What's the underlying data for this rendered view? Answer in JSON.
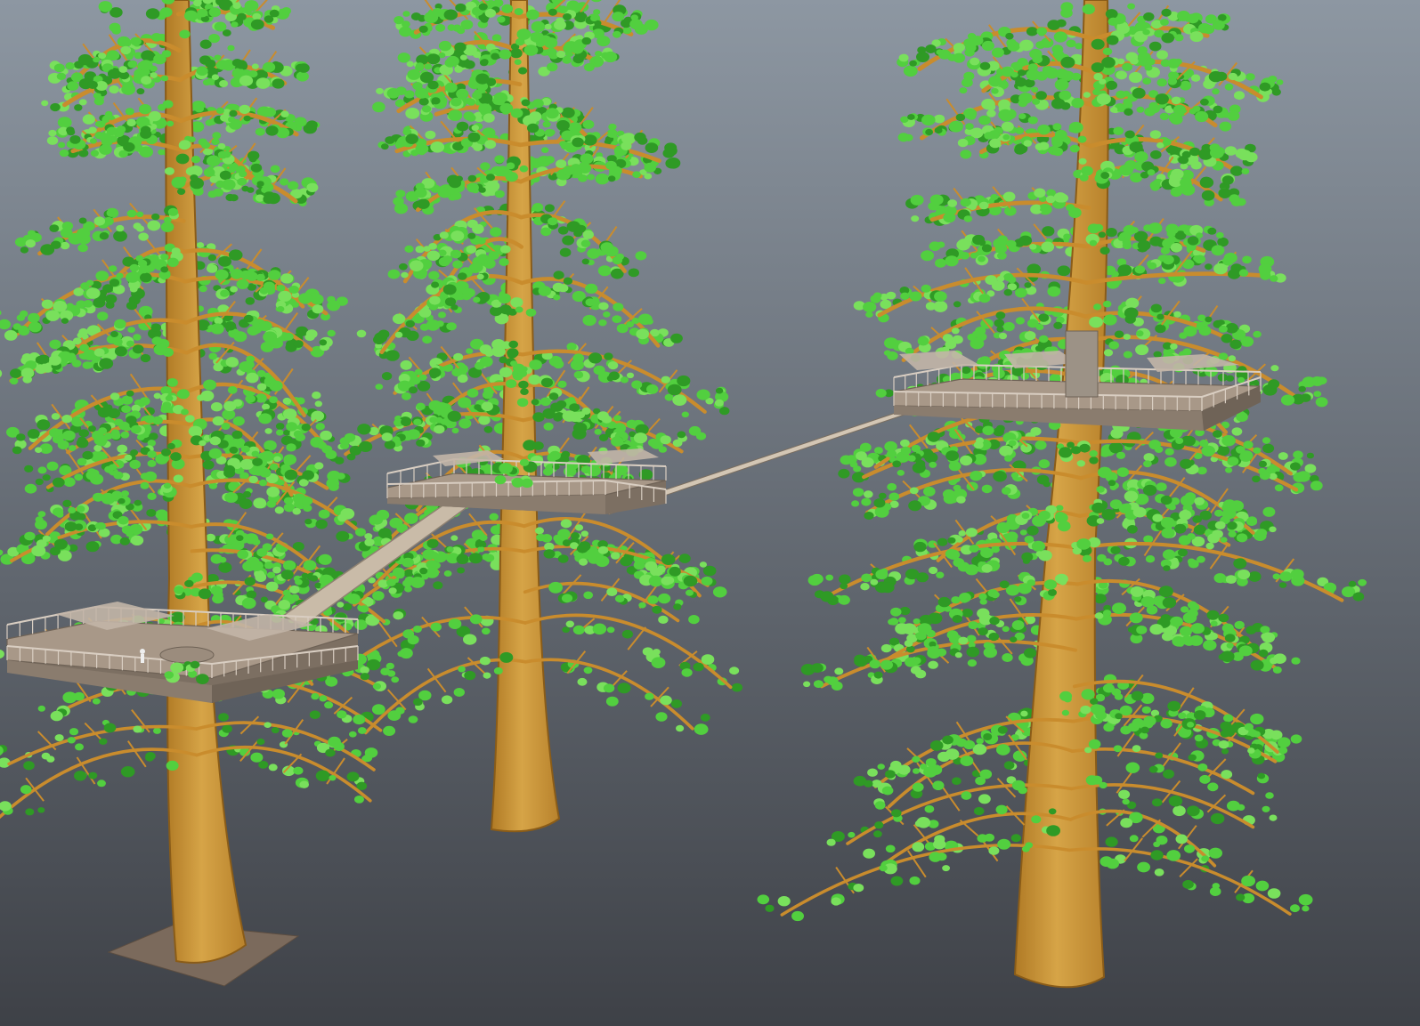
{
  "viewport": {
    "background_top": "#8d97a2",
    "background_bottom": "#3e4147",
    "label": ""
  },
  "colors": {
    "trunk": "#c8963a",
    "trunk_shade": "#9c6c1f",
    "branch": "#c98c2d",
    "leaf": "#52cf3f",
    "leaf_dark": "#2f9a25",
    "leaf_light": "#79e05c",
    "deck": "#a89888",
    "deck_dark": "#7c6f62",
    "railing": "#d9cec2",
    "bridge": "#c9bba8",
    "ground_plane": "#7b6a5c"
  },
  "scene": {
    "trees": [
      {
        "name": "tree-left",
        "has_platform": true,
        "has_ground_plane": true
      },
      {
        "name": "tree-middle",
        "has_platform": true,
        "has_ground_plane": false
      },
      {
        "name": "tree-right",
        "has_platform": true,
        "has_ground_plane": false
      }
    ],
    "bridges": [
      {
        "name": "ramp-left-to-middle",
        "from": "tree-left",
        "to": "tree-middle"
      },
      {
        "name": "cable-middle-to-right",
        "from": "tree-middle",
        "to": "tree-right"
      }
    ]
  }
}
